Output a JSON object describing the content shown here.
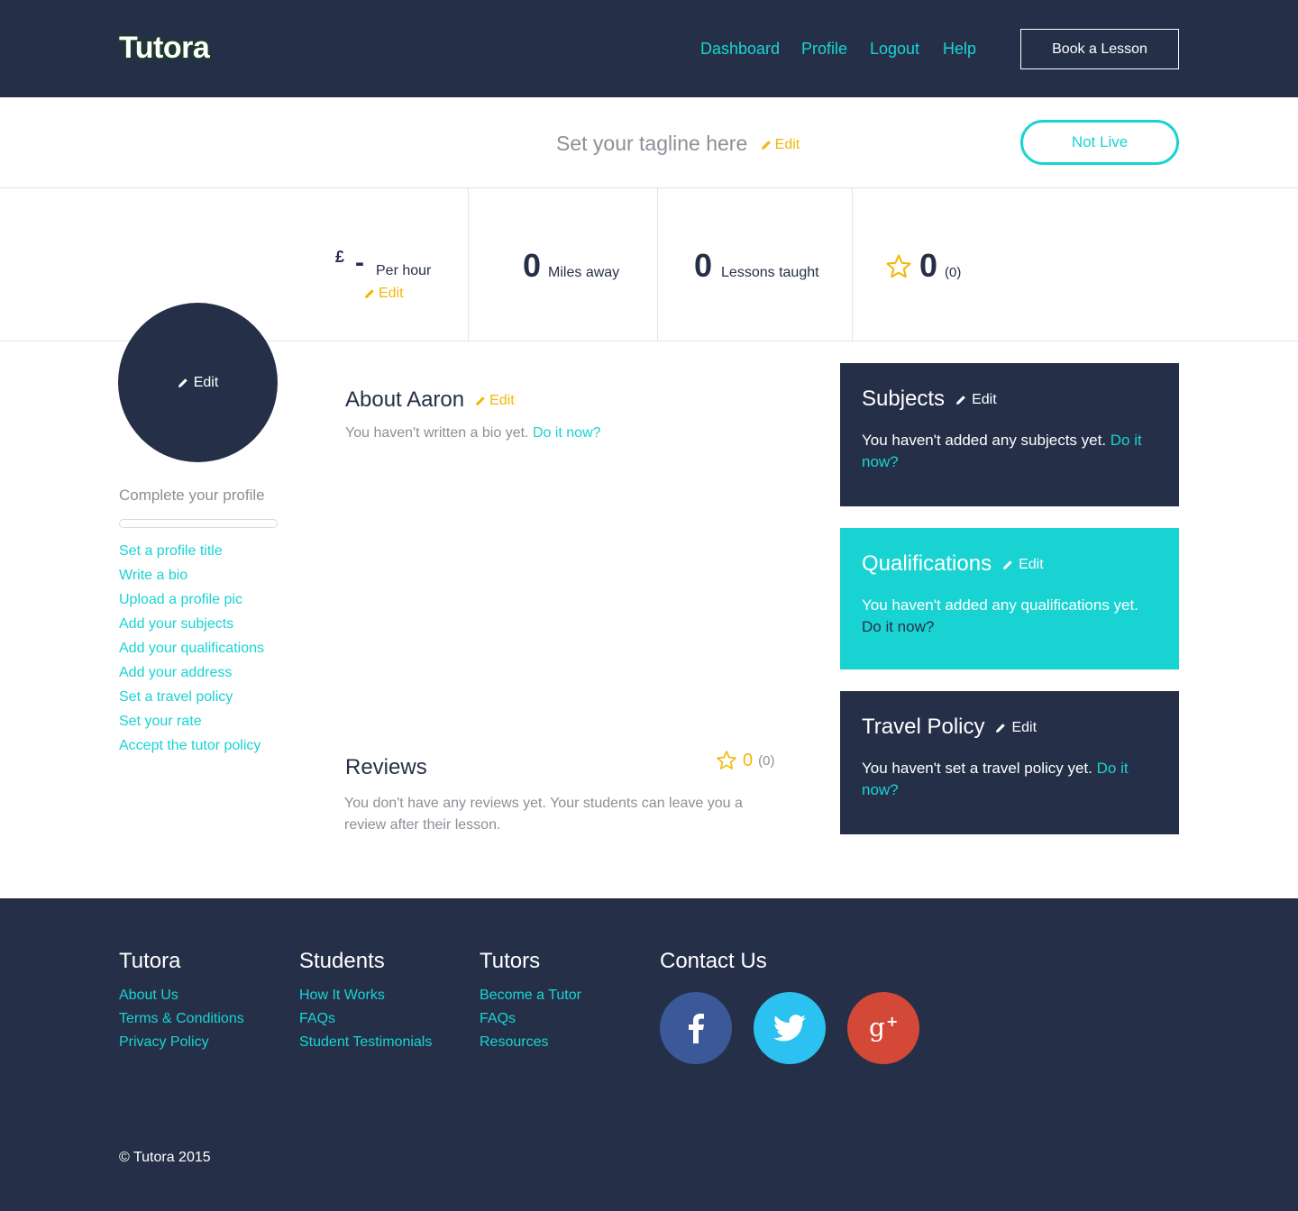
{
  "header": {
    "logo": "Tutora",
    "nav": [
      "Dashboard",
      "Profile",
      "Logout",
      "Help"
    ],
    "book_button": "Book a Lesson"
  },
  "tagline": {
    "text": "Set your tagline here",
    "edit": "Edit",
    "status_button": "Not Live"
  },
  "stats": {
    "rate": {
      "currency": "£",
      "value": "-",
      "label": "Per hour",
      "edit": "Edit"
    },
    "distance": {
      "value": "0",
      "label": "Miles away"
    },
    "lessons": {
      "value": "0",
      "label": "Lessons taught"
    },
    "rating": {
      "value": "0",
      "count": "(0)"
    }
  },
  "sidebar": {
    "avatar_edit": "Edit",
    "complete_title": "Complete your profile",
    "progress": 0,
    "todos": [
      "Set a profile title",
      "Write a bio",
      "Upload a profile pic",
      "Add your subjects",
      "Add your qualifications",
      "Add your address",
      "Set a travel policy",
      "Set your rate",
      "Accept the tutor policy"
    ]
  },
  "about": {
    "title": "About Aaron",
    "edit": "Edit",
    "text": "You haven't written a bio yet.",
    "link": "Do it now?"
  },
  "reviews": {
    "title": "Reviews",
    "rating": "0",
    "count": "(0)",
    "text": "You don't have any reviews yet. Your students can leave you a review after their lesson."
  },
  "panels": {
    "subjects": {
      "title": "Subjects",
      "edit": "Edit",
      "text": "You haven't added any subjects yet.",
      "link": "Do it now?"
    },
    "qualifications": {
      "title": "Qualifications",
      "edit": "Edit",
      "text": "You haven't added any qualifications yet.",
      "link": "Do it now?"
    },
    "travel": {
      "title": "Travel Policy",
      "edit": "Edit",
      "text": "You haven't set a travel policy yet.",
      "link": "Do it now?"
    }
  },
  "footer": {
    "tutora": {
      "title": "Tutora",
      "links": [
        "About Us",
        "Terms & Conditions",
        "Privacy Policy"
      ]
    },
    "students": {
      "title": "Students",
      "links": [
        "How It Works",
        "FAQs",
        "Student Testimonials"
      ]
    },
    "tutors": {
      "title": "Tutors",
      "links": [
        "Become a Tutor",
        "FAQs",
        "Resources"
      ]
    },
    "contact": {
      "title": "Contact Us",
      "social": [
        "facebook-icon",
        "twitter-icon",
        "google-plus-icon"
      ]
    },
    "copyright": "© Tutora 2015"
  },
  "colors": {
    "navy": "#253048",
    "teal": "#19d3d2",
    "yellow": "#f2b705",
    "facebook": "#3b5998",
    "twitter": "#2bc1f0",
    "google": "#d34836"
  }
}
